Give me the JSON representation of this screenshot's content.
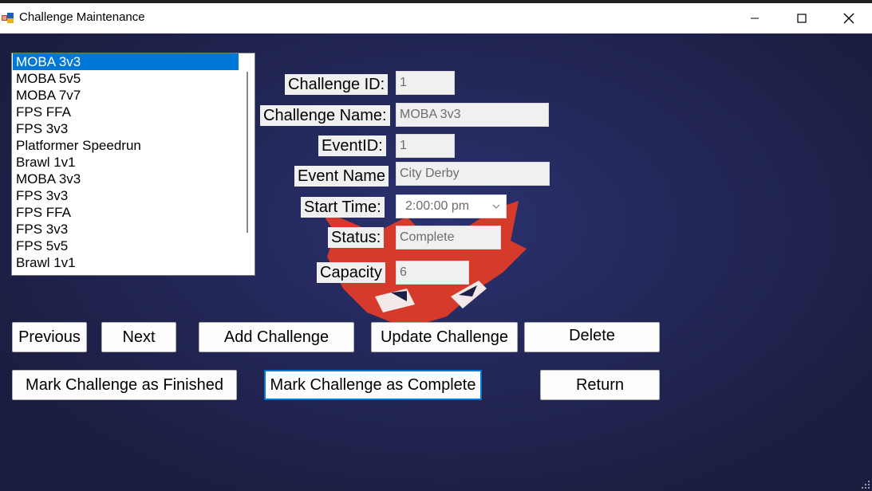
{
  "window": {
    "title": "Challenge Maintenance",
    "controls": {
      "minimize": "minimize-icon",
      "maximize": "maximize-icon",
      "close": "close-icon"
    }
  },
  "challenges_list": {
    "selected_index": 0,
    "items": [
      "MOBA 3v3",
      "MOBA 5v5",
      "MOBA 7v7",
      "FPS FFA",
      "FPS 3v3",
      "Platformer Speedrun",
      "Brawl 1v1",
      "MOBA 3v3",
      "FPS 3v3",
      "FPS FFA",
      "FPS 3v3",
      "FPS 5v5",
      "Brawl 1v1"
    ]
  },
  "form": {
    "challenge_id_label": "Challenge ID:",
    "challenge_id_value": "1",
    "challenge_name_label": "Challenge Name:",
    "challenge_name_value": "MOBA 3v3",
    "event_id_label": "EventID:",
    "event_id_value": "1",
    "event_name_label": "Event Name",
    "event_name_value": "City Derby",
    "start_time_label": "Start Time:",
    "start_time_value": "2:00:00 pm",
    "status_label": "Status:",
    "status_value": "Complete",
    "capacity_label": "Capacity",
    "capacity_value": "6"
  },
  "buttons": {
    "previous": "Previous",
    "next": "Next",
    "add": "Add Challenge",
    "update": "Update Challenge",
    "delete": "Delete",
    "mark_finished": "Mark Challenge as Finished",
    "mark_complete": "Mark Challenge as Complete",
    "return": "Return"
  },
  "colors": {
    "background": "#1e2146",
    "mascot": "#d63a2a",
    "selection": "#0078d7"
  }
}
